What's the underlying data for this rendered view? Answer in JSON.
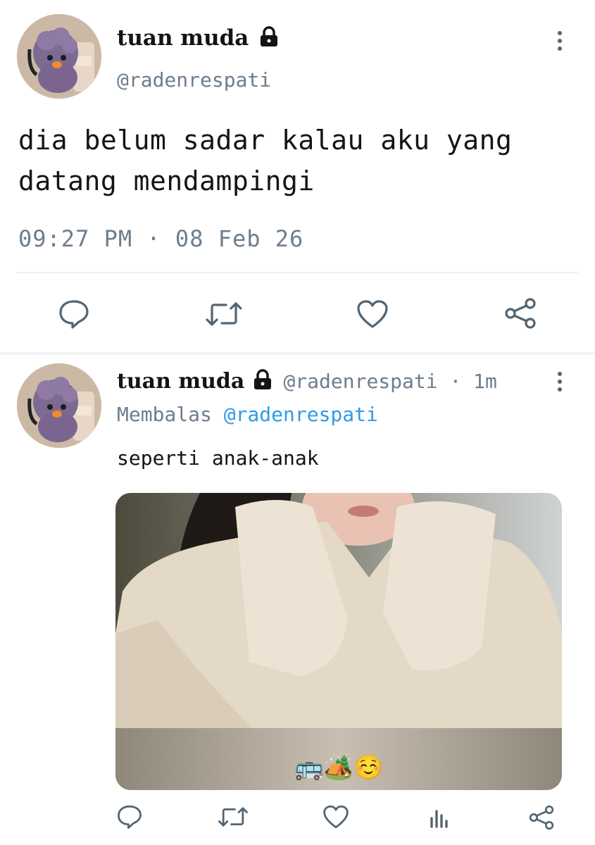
{
  "main_tweet": {
    "display_name": "tuan muda",
    "lock_icon": "lock-icon",
    "handle": "@radenrespati",
    "text_line1": "dia belum sadar kalau aku yang",
    "text_line2": "datang mendampingi",
    "timestamp": "09:27 PM · 08 Feb 26",
    "actions": [
      "reply-icon",
      "retweet-icon",
      "like-icon",
      "share-icon"
    ]
  },
  "reply_tweet": {
    "display_name": "tuan muda",
    "lock_icon": "lock-icon",
    "handle_time": "@radenrespati · 1m",
    "replying_prefix": "Membalas",
    "replying_to": "@radenrespati",
    "text": "seperti anak-anak",
    "media_caption": "🚌🏕️☺️",
    "actions": [
      "reply-icon",
      "retweet-icon",
      "like-icon",
      "analytics-icon",
      "share-icon"
    ]
  },
  "colors": {
    "text": "#141414",
    "muted": "#6e7d8d",
    "link": "#2f9be6",
    "icon": "#536471",
    "divider": "#eceff1"
  }
}
